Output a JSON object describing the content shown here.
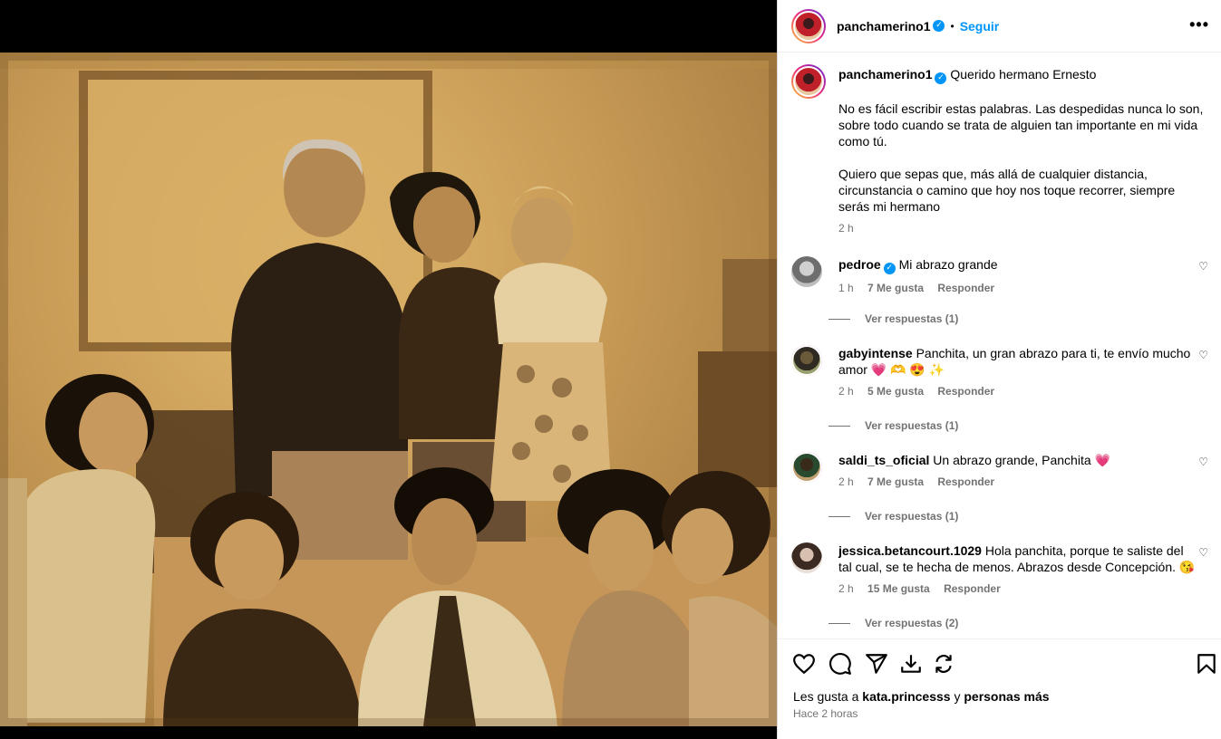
{
  "header": {
    "username": "panchamerino1",
    "follow_label": "Seguir",
    "more_icon": "more-horizontal-icon"
  },
  "caption": {
    "username": "panchamerino1",
    "title": "Querido hermano Ernesto",
    "paragraph1": "No es fácil escribir estas palabras. Las despedidas nunca lo son, sobre todo cuando se trata de alguien tan importante en mi vida como tú.",
    "paragraph2": "Quiero que sepas que, más allá de cualquier distancia, circunstancia o camino que hoy nos toque recorrer, siempre serás mi hermano",
    "time": "2 h"
  },
  "comments": [
    {
      "username": "pedroe",
      "verified": true,
      "text": "Mi abrazo grande",
      "time": "1 h",
      "likes": "7 Me gusta",
      "reply_label": "Responder",
      "replies_label": "Ver respuestas (1)"
    },
    {
      "username": "gabyintense",
      "verified": false,
      "text": "Panchita, un gran abrazo para ti, te envío mucho amor 💗 🫶 😍 ✨",
      "time": "2 h",
      "likes": "5 Me gusta",
      "reply_label": "Responder",
      "replies_label": "Ver respuestas (1)"
    },
    {
      "username": "saldi_ts_oficial",
      "verified": false,
      "text": "Un abrazo grande, Panchita 💗",
      "time": "2 h",
      "likes": "7 Me gusta",
      "reply_label": "Responder",
      "replies_label": "Ver respuestas (1)"
    },
    {
      "username": "jessica.betancourt.1029",
      "verified": false,
      "text": "Hola panchita, porque te saliste del tal cual, se te hecha de menos. Abrazos desde Concepción. 😘",
      "time": "2 h",
      "likes": "15 Me gusta",
      "reply_label": "Responder",
      "replies_label": "Ver respuestas (2)"
    }
  ],
  "actions": {
    "icons": [
      "heart-icon",
      "comment-icon",
      "share-icon",
      "repost-icon",
      "save-icon"
    ]
  },
  "likes": {
    "prefix": "Les gusta a",
    "user": "kata.princesss",
    "connector": "y",
    "others": "personas más"
  },
  "posted_ago": "Hace 2 horas",
  "colors": {
    "accent": "#0095f6",
    "sepia": "#c79a55"
  }
}
